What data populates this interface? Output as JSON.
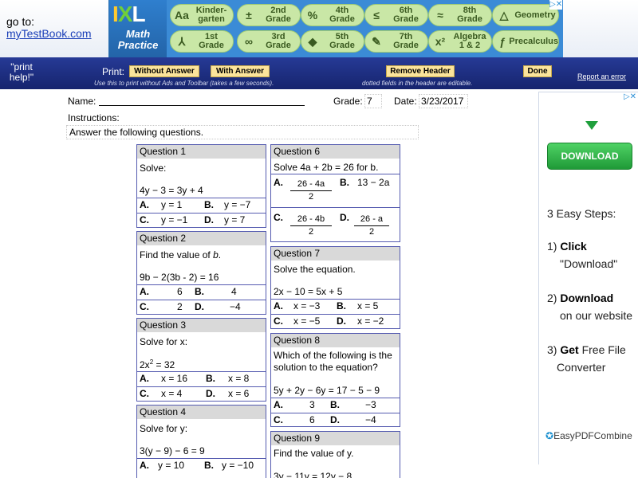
{
  "topbar": {
    "goto_label": "go to:",
    "goto_link": "myTestBook.com",
    "ad_close": "▷✕",
    "ixl": {
      "logo_letters": [
        "I",
        "X",
        "L"
      ],
      "subtitle_line1": "Math",
      "subtitle_line2": "Practice",
      "grades": [
        {
          "icon": "Aa",
          "line1": "Kinder-",
          "line2": "garten"
        },
        {
          "icon": "±",
          "line1": "2nd",
          "line2": "Grade"
        },
        {
          "icon": "%",
          "line1": "4th",
          "line2": "Grade"
        },
        {
          "icon": "≤",
          "line1": "6th",
          "line2": "Grade"
        },
        {
          "icon": "≈",
          "line1": "8th",
          "line2": "Grade"
        },
        {
          "icon": "△",
          "line1": "Geometry",
          "line2": ""
        },
        {
          "icon": "⅄",
          "line1": "1st",
          "line2": "Grade"
        },
        {
          "icon": "∞",
          "line1": "3rd",
          "line2": "Grade"
        },
        {
          "icon": "◆",
          "line1": "5th",
          "line2": "Grade"
        },
        {
          "icon": "✎",
          "line1": "7th",
          "line2": "Grade"
        },
        {
          "icon": "x²",
          "line1": "Algebra",
          "line2": "1 & 2"
        },
        {
          "icon": "ƒ",
          "line1": "Precalculus",
          "line2": ""
        }
      ]
    }
  },
  "toolbar": {
    "print_help_line1": "\"print",
    "print_help_line2": "help!\"",
    "print_label": "Print:",
    "without_answer": "Without Answer",
    "with_answer": "With Answer",
    "note_left": "Use this to print without Ads and Toolbar (takes a few seconds).",
    "remove_header": "Remove Header",
    "note_right": "dotted fields in the header are editable.",
    "done": "Done",
    "report": "Report an error"
  },
  "sheet": {
    "name_label": "Name:",
    "grade_label": "Grade:",
    "grade_value": "7",
    "date_label": "Date:",
    "date_value": "3/23/2017",
    "instructions_label": "Instructions:",
    "instructions_text": "Answer the following questions."
  },
  "questions": {
    "q1": {
      "title": "Question 1",
      "prompt": "Solve:",
      "expr": "4y − 3 = 3y + 4",
      "a": "y = 1",
      "b": "y = −7",
      "c": "y = −1",
      "d": "y = 7"
    },
    "q2": {
      "title": "Question 2",
      "prompt_pre": "Find the value of ",
      "prompt_var": "b",
      "prompt_post": ".",
      "expr": "9b − 2(3b - 2) = 16",
      "a": "6",
      "b": "4",
      "c": "2",
      "d": "−4"
    },
    "q3": {
      "title": "Question 3",
      "prompt": "Solve for x:",
      "expr_base": "2x",
      "expr_exp": "2",
      "expr_rest": " = 32",
      "a": "x = 16",
      "b": "x = 8",
      "c": "x = 4",
      "d": "x = 6"
    },
    "q4": {
      "title": "Question 4",
      "prompt": "Solve for y:",
      "expr": "3(y − 9) − 6 = 9",
      "a": "y = 10",
      "b": "y = −10"
    },
    "q6": {
      "title": "Question 6",
      "prompt": "Solve 4a + 2b = 26 for b.",
      "a_num": "26 - 4a",
      "a_den": "2",
      "b": "13 − 2a",
      "c_num": "26 - 4b",
      "c_den": "2",
      "d_num": "26 - a",
      "d_den": "2"
    },
    "q7": {
      "title": "Question 7",
      "prompt": "Solve the equation.",
      "expr": "2x − 10 = 5x + 5",
      "a": "x = −3",
      "b": "x = 5",
      "c": "x = −5",
      "d": "x = −2"
    },
    "q8": {
      "title": "Question 8",
      "prompt_line1": "Which of the following is the",
      "prompt_line2": "solution to the equation?",
      "expr": "5y + 2y − 6y = 17 − 5 − 9",
      "a": "3",
      "b": "−3",
      "c": "6",
      "d": "−4"
    },
    "q9": {
      "title": "Question 9",
      "prompt": "Find the value of y.",
      "expr": "3y − 11y = 12y − 8"
    },
    "letters": {
      "a": "A.",
      "b": "B.",
      "c": "C.",
      "d": "D."
    }
  },
  "side_ad": {
    "close": "▷✕",
    "download": "DOWNLOAD",
    "steps_title": "3 Easy Steps:",
    "s1_num": "1) ",
    "s1_bold": "Click",
    "s1_line2": "\"Download\"",
    "s2_num": "2) ",
    "s2_bold": "Download",
    "s2_line2": "on our website",
    "s3_num": "3) ",
    "s3_bold": "Get",
    "s3_rest": " Free File",
    "s3_line2": "Converter",
    "brand": "EasyPDFCombine"
  },
  "colors": {
    "toolbar": "#1c2c82",
    "button": "#fbe49b",
    "question_border": "#555bb0",
    "question_header": "#d9d9d9",
    "download": "#2bb34a",
    "link": "#1a3fb8"
  }
}
